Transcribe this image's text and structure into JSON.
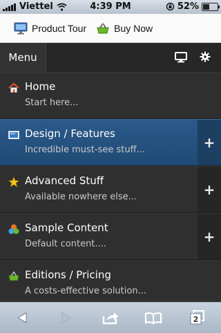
{
  "status_bar": {
    "carrier": "Viettel",
    "time": "4:39 PM",
    "battery_percent": "52%",
    "battery_level": 0.52,
    "icons": [
      "signal-icon",
      "wifi-icon",
      "orientation-lock-icon",
      "battery-icon"
    ]
  },
  "top_links": {
    "product_tour": "Product Tour",
    "buy_now": "Buy Now"
  },
  "menubar": {
    "menu_label": "Menu",
    "icons": [
      "monitor-icon",
      "gear-icon"
    ]
  },
  "items": [
    {
      "title": "Home",
      "subtitle": "Start here...",
      "icon": "home-icon",
      "expandable": false
    },
    {
      "title": "Design / Features",
      "subtitle": "Incredible must-see stuff...",
      "icon": "image-icon",
      "expandable": true,
      "active": true
    },
    {
      "title": "Advanced Stuff",
      "subtitle": "Available nowhere else...",
      "icon": "star-icon",
      "expandable": true
    },
    {
      "title": "Sample Content",
      "subtitle": "Default content....",
      "icon": "shapes-icon",
      "expandable": true
    },
    {
      "title": "Editions / Pricing",
      "subtitle": "A costs-effective solution...",
      "icon": "basket-icon",
      "expandable": false
    }
  ],
  "plus_label": "+",
  "toolbar": {
    "tabs_count": "2",
    "icons": [
      "back-icon",
      "forward-icon",
      "share-icon",
      "bookmarks-icon",
      "tabs-icon"
    ]
  },
  "colors": {
    "active_row": "#2b5a8a",
    "list_bg": "#2f2f2f",
    "accent_green": "#6ab82c"
  }
}
